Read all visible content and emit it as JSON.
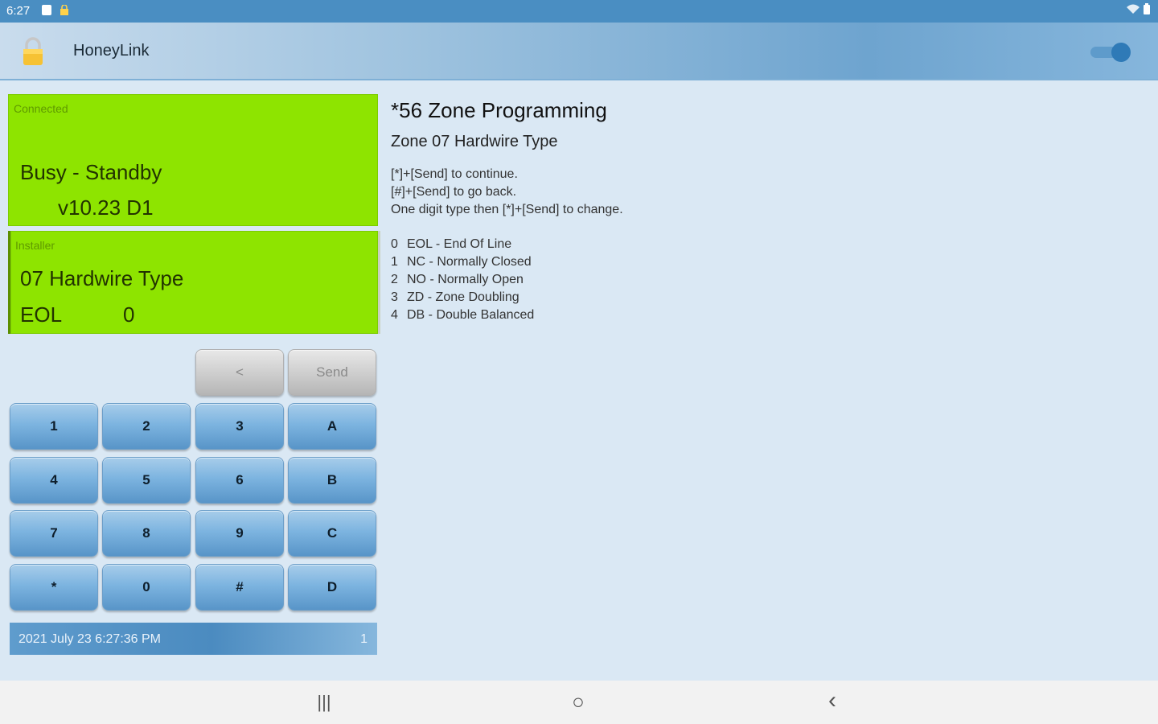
{
  "status_bar": {
    "time": "6:27",
    "left_icons": [
      "image-icon",
      "lock-icon"
    ],
    "right_icons": [
      "wifi-icon",
      "battery-icon"
    ]
  },
  "app_bar": {
    "title": "HoneyLink",
    "lock_icon": "padlock-icon",
    "toggle_on": true,
    "accent_color": "#2f7ab7"
  },
  "connection_panel": {
    "label": "Connected",
    "status": "Busy - Standby",
    "version": "v10.23 D1",
    "color": "#8ee400"
  },
  "installer_panel": {
    "label": "Installer",
    "line1": "07 Hardwire Type",
    "eol_label": "EOL",
    "eol_value": "0"
  },
  "keypad": {
    "top_row": [
      "<",
      "Send"
    ],
    "rows": [
      [
        "1",
        "2",
        "3",
        "A"
      ],
      [
        "4",
        "5",
        "6",
        "B"
      ],
      [
        "7",
        "8",
        "9",
        "C"
      ],
      [
        "*",
        "0",
        "#",
        "D"
      ]
    ]
  },
  "footer": {
    "datetime": "2021 July 23   6:27:36 PM",
    "count": "1"
  },
  "info": {
    "title": "*56 Zone Programming",
    "subtitle": "Zone 07 Hardwire Type",
    "instructions": [
      "[*]+[Send] to continue.",
      "[#]+[Send] to go back.",
      "One digit type then [*]+[Send] to change."
    ],
    "options": [
      {
        "num": "0",
        "text": "EOL - End Of Line"
      },
      {
        "num": "1",
        "text": "NC - Normally Closed"
      },
      {
        "num": "2",
        "text": "NO - Normally Open"
      },
      {
        "num": "3",
        "text": "ZD - Zone Doubling"
      },
      {
        "num": "4",
        "text": "DB - Double Balanced"
      }
    ]
  },
  "nav_bar": {
    "recents": "|||",
    "home": "○",
    "back": "‹"
  }
}
